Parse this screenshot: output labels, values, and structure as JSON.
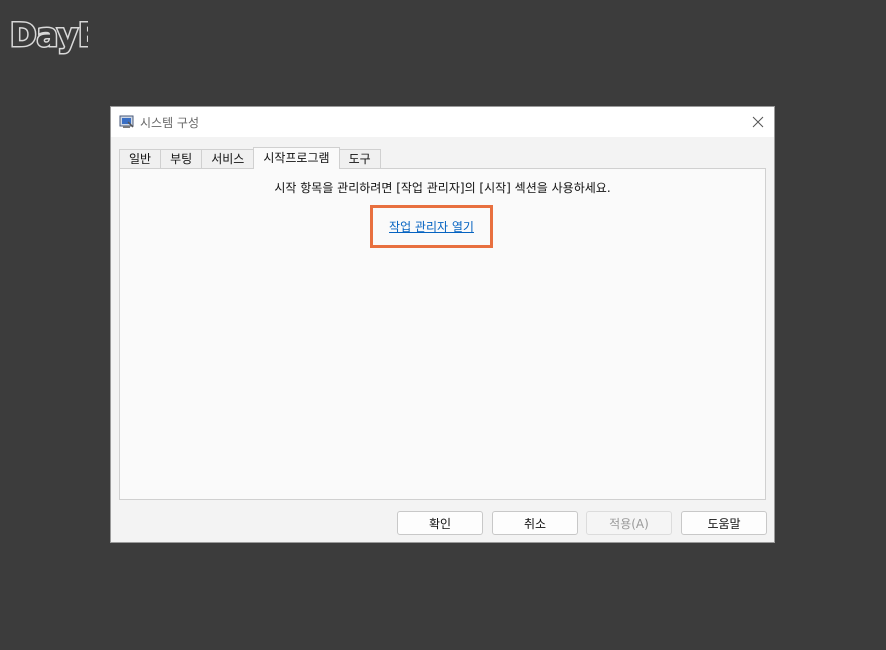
{
  "watermark": {
    "text": "DayB"
  },
  "window": {
    "title": "시스템 구성",
    "icon": "msconfig-icon"
  },
  "tabs": [
    {
      "label": "일반",
      "active": false
    },
    {
      "label": "부팅",
      "active": false
    },
    {
      "label": "서비스",
      "active": false
    },
    {
      "label": "시작프로그램",
      "active": true
    },
    {
      "label": "도구",
      "active": false
    }
  ],
  "startup": {
    "description": "시작 항목을 관리하려면 [작업 관리자]의 [시작] 섹션을 사용하세요.",
    "link_label": "작업 관리자 열기"
  },
  "buttons": {
    "ok": "확인",
    "cancel": "취소",
    "apply": "적용(A)",
    "help": "도움말"
  },
  "colors": {
    "highlight": "#e8703f",
    "link": "#0563c1"
  }
}
